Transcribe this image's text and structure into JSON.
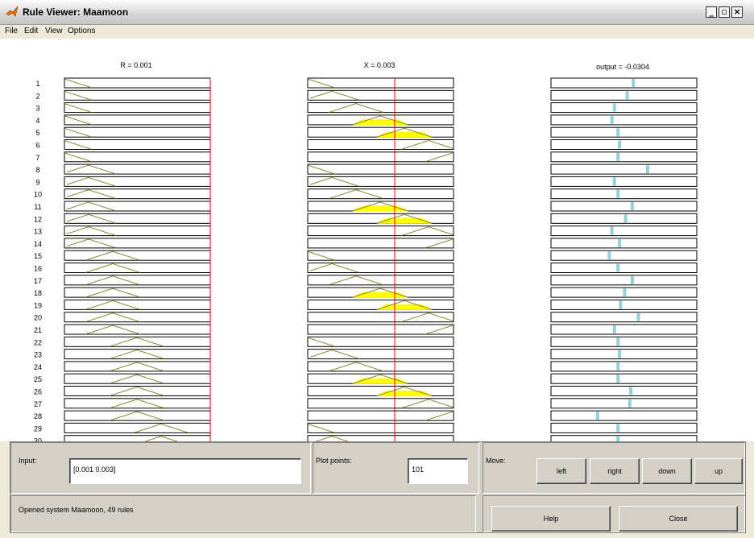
{
  "window": {
    "title": "Rule Viewer: Maamoon"
  },
  "menu": [
    "File",
    "Edit",
    "View",
    "Options"
  ],
  "columns": [
    {
      "label": "R = 0.001"
    },
    {
      "label": "X = 0.003"
    },
    {
      "label": "output = -0.0304"
    }
  ],
  "rule_numbers": [
    "1",
    "2",
    "3",
    "4",
    "5",
    "6",
    "7",
    "8",
    "9",
    "10",
    "11",
    "12",
    "13",
    "14",
    "15",
    "16",
    "17",
    "18",
    "19",
    "20",
    "21",
    "22",
    "23",
    "24",
    "25",
    "26",
    "27",
    "28",
    "29",
    "30"
  ],
  "colors": {
    "mf_line": "#6b6b00",
    "fill": "#ffff00",
    "indicator": "#e60000",
    "output_bar": "#92d0dc"
  },
  "rules": {
    "r_mf_center": [
      0,
      0,
      0,
      0,
      0,
      0,
      0,
      1,
      1,
      1,
      1,
      1,
      1,
      1,
      2,
      2,
      2,
      2,
      2,
      2,
      2,
      3,
      3,
      3,
      3,
      3,
      3,
      3,
      4,
      4
    ],
    "x_mf_center": [
      0,
      1,
      2,
      3,
      4,
      5,
      6,
      0,
      1,
      2,
      3,
      4,
      5,
      6,
      0,
      1,
      2,
      3,
      4,
      5,
      6,
      0,
      1,
      2,
      3,
      4,
      5,
      6,
      0,
      1
    ],
    "output_value": [
      0.47,
      0.35,
      0.1,
      0.05,
      0.17,
      0.2,
      0.17,
      0.75,
      0.1,
      0.17,
      0.45,
      0.32,
      0.05,
      0.2,
      0.0,
      0.17,
      0.45,
      0.3,
      0.22,
      0.57,
      0.1,
      0.17,
      0.2,
      0.17,
      0.17,
      0.42,
      0.4,
      -0.23,
      0.17,
      0.17
    ]
  },
  "input": {
    "label": "Input:",
    "value": "[0.001 0.003]"
  },
  "plot_points": {
    "label": "Plot points:",
    "value": "101"
  },
  "move": {
    "label": "Move:",
    "left": "left",
    "right": "right",
    "down": "down",
    "up": "up"
  },
  "status": {
    "text": "Opened system Maamoon, 49 rules"
  },
  "buttons": {
    "help": "Help",
    "close": "Close"
  }
}
